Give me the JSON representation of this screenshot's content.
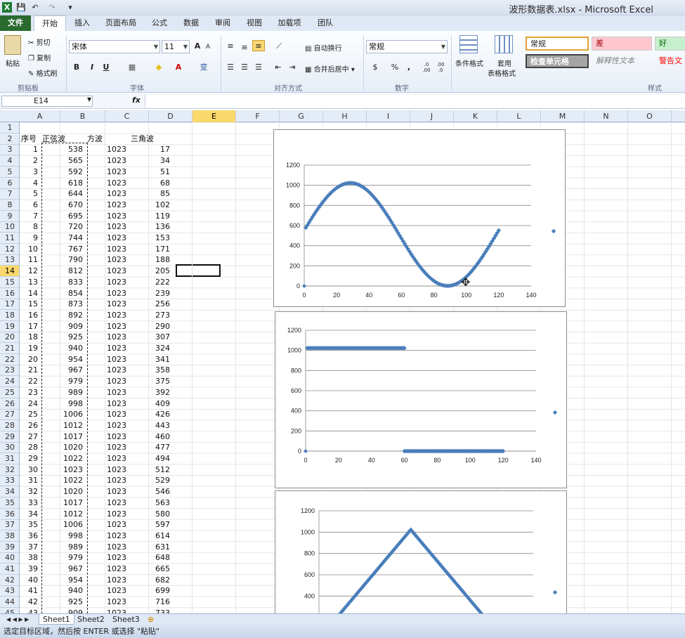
{
  "window": {
    "title": "波形数据表.xlsx - Microsoft Excel"
  },
  "quick_access": [
    "X",
    "💾",
    "↶",
    "↷",
    "▾"
  ],
  "tabs": [
    "文件",
    "开始",
    "插入",
    "页面布局",
    "公式",
    "数据",
    "审阅",
    "视图",
    "加载项",
    "团队"
  ],
  "ribbon": {
    "clipboard": {
      "paste": "粘贴",
      "cut": "剪切",
      "copy": "复制",
      "format_painter": "格式刷",
      "label": "剪贴板"
    },
    "font": {
      "name": "宋体",
      "size": "11",
      "label": "字体",
      "bold": "B",
      "italic": "I",
      "underline": "U",
      "grow": "A",
      "shrink": "A",
      "border": "▦",
      "fill": "◆",
      "color": "A",
      "phonetic": "变"
    },
    "alignment": {
      "wrap": "自动换行",
      "merge": "合并后居中",
      "label": "对齐方式"
    },
    "number": {
      "format": "常规",
      "label": "数字",
      "currency": "$",
      "percent": "%",
      "comma": ",",
      "inc_dec": ".0 .00",
      "dec_dec": ".00 .0"
    },
    "styles": {
      "conditional": "条件格式",
      "table": "套用",
      "table2": "表格格式",
      "label": "样式",
      "normal": "常规",
      "bad": "差",
      "good": "好",
      "check": "检查单元格",
      "explain": "解释性文本",
      "warn": "警告文"
    }
  },
  "formula_bar": {
    "name_box": "E14",
    "fx": "fx",
    "content": ""
  },
  "columns": [
    "A",
    "B",
    "C",
    "D",
    "E",
    "F",
    "G",
    "H",
    "I",
    "J",
    "K",
    "L",
    "M",
    "N",
    "O",
    "P"
  ],
  "selected_col": "E",
  "selected_row": 14,
  "rows": [
    "1",
    "2",
    "3",
    "4",
    "5",
    "6",
    "7",
    "8",
    "9",
    "10",
    "11",
    "12",
    "13",
    "14",
    "15",
    "16",
    "17",
    "18",
    "19",
    "20",
    "21",
    "22",
    "23",
    "24",
    "25",
    "26",
    "27",
    "28",
    "29",
    "30",
    "31",
    "32",
    "33",
    "34",
    "35",
    "36",
    "37",
    "38",
    "39",
    "40",
    "41",
    "42",
    "43",
    "44",
    "45"
  ],
  "headers": {
    "a": "序号",
    "b": "正弦波",
    "c": "方波",
    "d": "三角波"
  },
  "data": [
    [
      1,
      538,
      1023,
      17
    ],
    [
      2,
      565,
      1023,
      34
    ],
    [
      3,
      592,
      1023,
      51
    ],
    [
      4,
      618,
      1023,
      68
    ],
    [
      5,
      644,
      1023,
      85
    ],
    [
      6,
      670,
      1023,
      102
    ],
    [
      7,
      695,
      1023,
      119
    ],
    [
      8,
      720,
      1023,
      136
    ],
    [
      9,
      744,
      1023,
      153
    ],
    [
      10,
      767,
      1023,
      171
    ],
    [
      11,
      790,
      1023,
      188
    ],
    [
      12,
      812,
      1023,
      205
    ],
    [
      13,
      833,
      1023,
      222
    ],
    [
      14,
      854,
      1023,
      239
    ],
    [
      15,
      873,
      1023,
      256
    ],
    [
      16,
      892,
      1023,
      273
    ],
    [
      17,
      909,
      1023,
      290
    ],
    [
      18,
      925,
      1023,
      307
    ],
    [
      19,
      940,
      1023,
      324
    ],
    [
      20,
      954,
      1023,
      341
    ],
    [
      21,
      967,
      1023,
      358
    ],
    [
      22,
      979,
      1023,
      375
    ],
    [
      23,
      989,
      1023,
      392
    ],
    [
      24,
      998,
      1023,
      409
    ],
    [
      25,
      1006,
      1023,
      426
    ],
    [
      26,
      1012,
      1023,
      443
    ],
    [
      27,
      1017,
      1023,
      460
    ],
    [
      28,
      1020,
      1023,
      477
    ],
    [
      29,
      1022,
      1023,
      494
    ],
    [
      30,
      1023,
      1023,
      512
    ],
    [
      31,
      1022,
      1023,
      529
    ],
    [
      32,
      1020,
      1023,
      546
    ],
    [
      33,
      1017,
      1023,
      563
    ],
    [
      34,
      1012,
      1023,
      580
    ],
    [
      35,
      1006,
      1023,
      597
    ],
    [
      36,
      998,
      1023,
      614
    ],
    [
      37,
      989,
      1023,
      631
    ],
    [
      38,
      979,
      1023,
      648
    ],
    [
      39,
      967,
      1023,
      665
    ],
    [
      40,
      954,
      1023,
      682
    ],
    [
      41,
      940,
      1023,
      699
    ],
    [
      42,
      925,
      1023,
      716
    ],
    [
      43,
      909,
      1023,
      733
    ]
  ],
  "chart_data": [
    {
      "type": "scatter",
      "series_color": "#4a7ebb",
      "xlim": [
        0,
        140
      ],
      "ylim": [
        0,
        1200
      ],
      "xticks": [
        "0",
        "20",
        "40",
        "60",
        "80",
        "100",
        "120",
        "140"
      ],
      "yticks": [
        "0",
        "200",
        "400",
        "600",
        "800",
        "1000",
        "1200"
      ],
      "series": [
        {
          "name": "",
          "kind": "sine",
          "x": [
            1,
            120
          ],
          "center": 512,
          "amp": 511,
          "phase_start": 538
        }
      ],
      "extra_points": [
        {
          "x": 0,
          "y": 0
        }
      ],
      "legend_marker": "◆"
    },
    {
      "type": "scatter",
      "series_color": "#4a7ebb",
      "xlim": [
        0,
        140
      ],
      "ylim": [
        0,
        1200
      ],
      "xticks": [
        "0",
        "20",
        "40",
        "60",
        "80",
        "100",
        "120",
        "140"
      ],
      "yticks": [
        "0",
        "200",
        "400",
        "600",
        "800",
        "1000",
        "1200"
      ],
      "series": [
        {
          "name": "",
          "kind": "square",
          "high": [
            1,
            60,
            1023
          ],
          "low": [
            60,
            120,
            0
          ]
        }
      ],
      "extra_points": [
        {
          "x": 0,
          "y": 0
        }
      ],
      "legend_marker": "◆"
    },
    {
      "type": "scatter",
      "series_color": "#4a7ebb",
      "xlim": [
        0,
        140
      ],
      "ylim": [
        0,
        1200
      ],
      "yticks": [
        "200",
        "400",
        "600",
        "800",
        "1000",
        "1200"
      ],
      "series": [
        {
          "name": "",
          "kind": "triangle",
          "peak_x": 60,
          "peak_y": 1023
        }
      ],
      "legend_marker": "◆"
    }
  ],
  "sheets": [
    "Sheet1",
    "Sheet2",
    "Sheet3"
  ],
  "status": "选定目标区域，然后按 ENTER 或选择 \"粘贴\""
}
